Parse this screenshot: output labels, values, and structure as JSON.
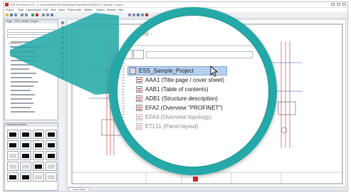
{
  "window": {
    "title": "EPLAN Electric P8 - C:\\Users\\Public\\EPLAN\\Data\\Projects\\EPLAN\\ESS_Sample_Project"
  },
  "menu": [
    "Project",
    "Page",
    "Layout space",
    "Edit",
    "View",
    "Insert",
    "Project data",
    "Utilities",
    "Options",
    "Window",
    "Help"
  ],
  "panels": {
    "navigator_title": "Page - ESS_Sample_Project",
    "navigator_filter": "Not activated",
    "graphical_preview_title": "Graphical preview"
  },
  "magnifier": {
    "canvas_title": "...ated -",
    "tree": [
      {
        "label": "ESS_Sample_Project",
        "icon": "project-icon",
        "selected": true
      },
      {
        "label": "AAA1 (Title page / cover sheet)",
        "icon": "page-icon"
      },
      {
        "label": "AAB1 (Table of contents)",
        "icon": "page-icon"
      },
      {
        "label": "ADB1 (Structure description)",
        "icon": "page-icon"
      },
      {
        "label": "EFA2 (Overview \"PROFINET\")",
        "icon": "page-icon"
      },
      {
        "label": "EFA4 (Overview topology)",
        "icon": "page-icon",
        "faded": true
      },
      {
        "label": "ETL11 (Panel layout)",
        "icon": "page-icon",
        "faded": true
      }
    ]
  },
  "bottom_tab": "=GAA+UNL/1",
  "colors": {
    "accent_teal": "#25a9a8",
    "selection_blue": "#b7cfee",
    "page_icon_red": "#c9202a",
    "schematic_red": "#d12a2a",
    "schematic_blue": "#2a55b8"
  }
}
